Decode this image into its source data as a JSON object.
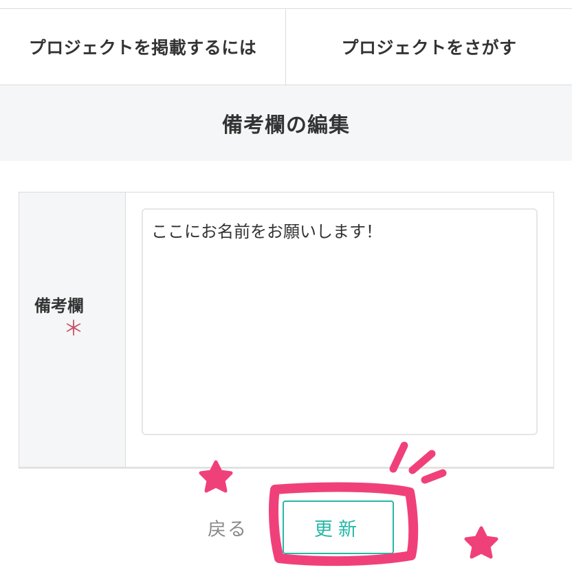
{
  "nav": {
    "tabs": [
      {
        "label": "プロジェクトを掲載するには"
      },
      {
        "label": "プロジェクトをさがす"
      }
    ]
  },
  "section": {
    "title": "備考欄の編集"
  },
  "form": {
    "field_label": "備考欄",
    "required_mark": "＊",
    "textarea_value": "ここにお名前をお願いします！"
  },
  "actions": {
    "back_label": "戻る",
    "update_label": "更新"
  },
  "colors": {
    "accent": "#25b7a6",
    "required": "#c8546a",
    "annotation": "#f0407a",
    "panel_bg": "#f4f6f7"
  }
}
